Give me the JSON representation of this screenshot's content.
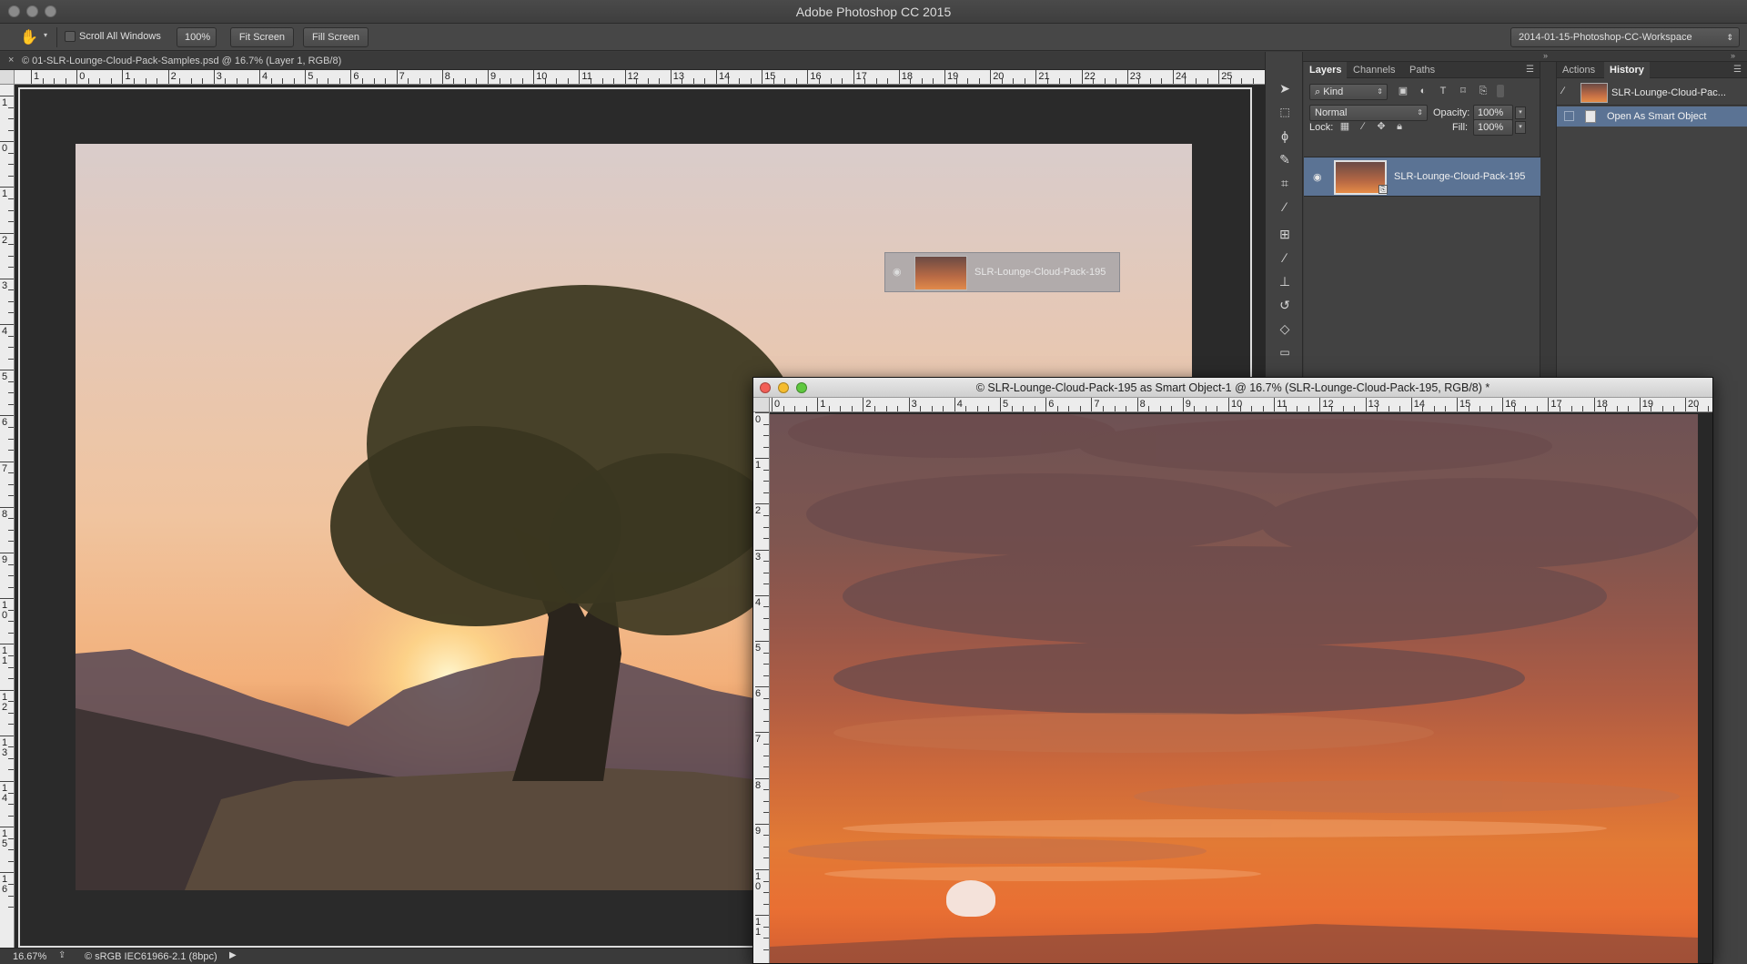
{
  "app": {
    "title": "Adobe Photoshop CC 2015",
    "accent": "#5b7394"
  },
  "options_bar": {
    "scroll_all_windows": "Scroll All Windows",
    "zoom_100": "100%",
    "fit_screen": "Fit Screen",
    "fill_screen": "Fill Screen",
    "workspace": "2014-01-15-Photoshop-CC-Workspace"
  },
  "document": {
    "tab_title": "© 01-SLR-Lounge-Cloud-Pack-Samples.psd @ 16.7% (Layer 1, RGB/8)",
    "ghost_layer_label": "SLR-Lounge-Cloud-Pack-195"
  },
  "rulers": {
    "main_h": [
      "1",
      "0",
      "1",
      "2",
      "3",
      "4",
      "5",
      "6",
      "7",
      "8",
      "9",
      "10",
      "11",
      "12",
      "13",
      "14",
      "15",
      "16",
      "17",
      "18",
      "19",
      "20",
      "21",
      "22",
      "23",
      "24",
      "25"
    ],
    "main_v": [
      "1",
      "0",
      "1",
      "2",
      "3",
      "4",
      "5",
      "6",
      "7",
      "8",
      "9",
      "10",
      "11",
      "12",
      "13",
      "14",
      "15",
      "16"
    ],
    "float_h": [
      "0",
      "1",
      "2",
      "3",
      "4",
      "5",
      "6",
      "7",
      "8",
      "9",
      "10",
      "11",
      "12",
      "13",
      "14",
      "15",
      "16",
      "17",
      "18",
      "19",
      "20"
    ],
    "float_v": [
      "0",
      "1",
      "2",
      "3",
      "4",
      "5",
      "6",
      "7",
      "8",
      "9",
      "10",
      "11"
    ]
  },
  "status": {
    "zoom": "16.67%",
    "profile": "© sRGB IEC61966-2.1 (8bpc)"
  },
  "layers_panel": {
    "tabs": [
      "Layers",
      "Channels",
      "Paths"
    ],
    "filter_kind": "Kind",
    "blend_mode": "Normal",
    "opacity_label": "Opacity:",
    "opacity_value": "100%",
    "lock_label": "Lock:",
    "fill_label": "Fill:",
    "fill_value": "100%",
    "layers": [
      {
        "name": "SLR-Lounge-Cloud-Pack-195",
        "selected": true
      }
    ]
  },
  "history_panel": {
    "tabs": [
      "Actions",
      "History"
    ],
    "snapshot": "SLR-Lounge-Cloud-Pac...",
    "steps": [
      "Open As Smart Object"
    ]
  },
  "float_window": {
    "title": "© SLR-Lounge-Cloud-Pack-195 as Smart Object-1 @ 16.7% (SLR-Lounge-Cloud-Pack-195, RGB/8) *"
  },
  "icons": {
    "hand_tool": "hand-icon",
    "eye": "eye-icon",
    "lock": "lock-icon"
  }
}
